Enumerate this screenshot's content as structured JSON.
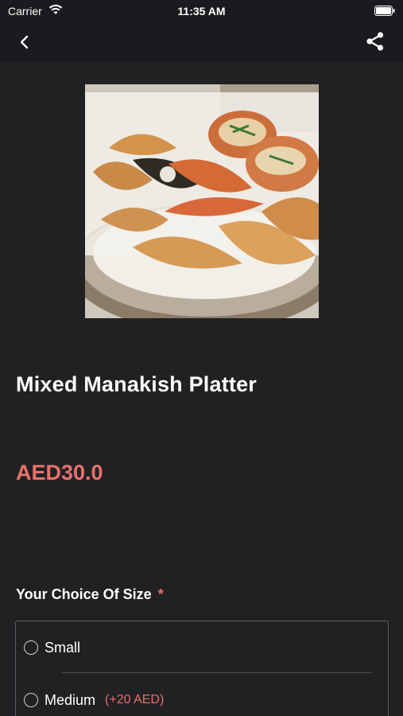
{
  "status_bar": {
    "carrier": "Carrier",
    "time": "11:35 AM"
  },
  "nav": {
    "back_icon": "chevron-left-icon",
    "share_icon": "share-icon"
  },
  "product": {
    "title": "Mixed Manakish Platter",
    "price": "AED30.0"
  },
  "size_section": {
    "heading": "Your Choice Of Size",
    "required_marker": "*",
    "options": [
      {
        "label": "Small",
        "extra": ""
      },
      {
        "label": "Medium",
        "extra": "(+20 AED)"
      }
    ]
  },
  "colors": {
    "background": "#212124",
    "bar": "#1a1b1e",
    "accent": "#e8716a"
  }
}
